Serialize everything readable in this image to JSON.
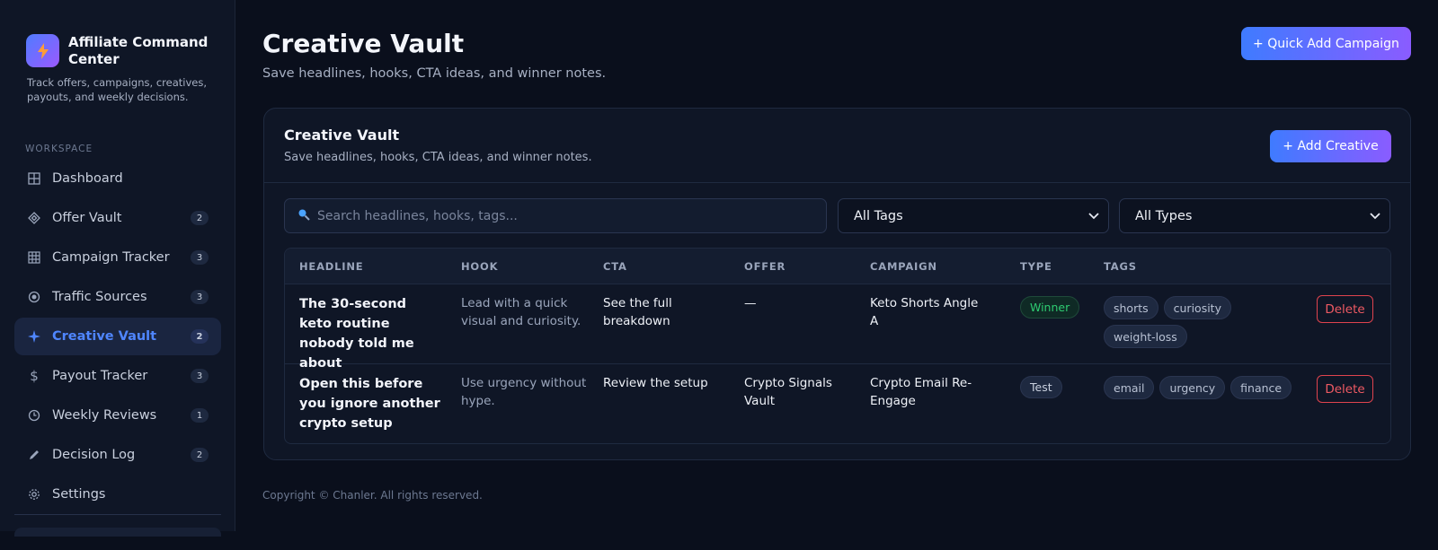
{
  "sidebar": {
    "brand_name": "Affiliate Command Center",
    "brand_desc": "Track offers, campaigns, creatives, payouts, and weekly decisions.",
    "section_label": "WORKSPACE",
    "items": [
      {
        "label": "Dashboard",
        "icon": "grid-icon",
        "badge": ""
      },
      {
        "label": "Offer Vault",
        "icon": "diamond-icon",
        "badge": "2"
      },
      {
        "label": "Campaign Tracker",
        "icon": "table-icon",
        "badge": "3"
      },
      {
        "label": "Traffic Sources",
        "icon": "target-icon",
        "badge": "3"
      },
      {
        "label": "Creative Vault",
        "icon": "sparkle-icon",
        "badge": "2",
        "active": true
      },
      {
        "label": "Payout Tracker",
        "icon": "dollar-icon",
        "badge": "3"
      },
      {
        "label": "Weekly Reviews",
        "icon": "clock-icon",
        "badge": "1"
      },
      {
        "label": "Decision Log",
        "icon": "pencil-icon",
        "badge": "2"
      },
      {
        "label": "Settings",
        "icon": "gear-icon",
        "badge": ""
      }
    ]
  },
  "header": {
    "title": "Creative Vault",
    "subtitle": "Save headlines, hooks, CTA ideas, and winner notes.",
    "quick_add_label": "+ Quick Add Campaign"
  },
  "panel": {
    "title": "Creative Vault",
    "subtitle": "Save headlines, hooks, CTA ideas, and winner notes.",
    "add_label": "+ Add Creative",
    "search_placeholder": "Search headlines, hooks, tags...",
    "tags_filter": "All Tags",
    "types_filter": "All Types"
  },
  "table": {
    "columns": [
      "HEADLINE",
      "HOOK",
      "CTA",
      "OFFER",
      "CAMPAIGN",
      "TYPE",
      "TAGS"
    ],
    "rows": [
      {
        "headline": "The 30-second keto routine nobody told me about",
        "hook": "Lead with a quick visual and curiosity.",
        "cta": "See the full breakdown",
        "offer": "—",
        "campaign": "Keto Shorts Angle A",
        "type": "Winner",
        "tags": [
          "shorts",
          "curiosity",
          "weight-loss"
        ],
        "delete_label": "Delete"
      },
      {
        "headline": "Open this before you ignore another crypto setup",
        "hook": "Use urgency without hype.",
        "cta": "Review the setup",
        "offer": "Crypto Signals Vault",
        "campaign": "Crypto Email Re-Engage",
        "type": "Test",
        "tags": [
          "email",
          "urgency",
          "finance"
        ],
        "delete_label": "Delete"
      }
    ]
  },
  "footer": {
    "copyright": "Copyright © Chanler. All rights reserved."
  },
  "colors": {
    "background": "#0a0f1c",
    "sidebar": "#0f1626",
    "accent": "#4f86ff",
    "gradient_start": "#3f7bff",
    "gradient_end": "#8a5cff",
    "winner": "#2ecc71",
    "danger": "#ef5a63"
  }
}
